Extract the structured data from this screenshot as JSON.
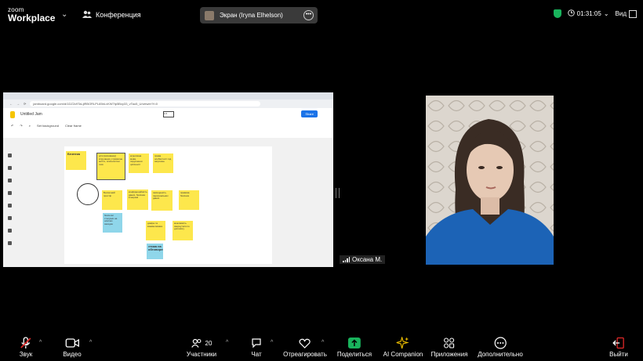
{
  "app": {
    "brand_line1": "zoom",
    "brand_line2": "Workplace",
    "meeting_title": "Конференция"
  },
  "screen_share": {
    "label": "Экран (Iryna Elhelson)"
  },
  "status": {
    "timer": "01:31:05",
    "view_label": "Вид"
  },
  "browser": {
    "url": "jamboard.google.com/d/1DZ2c9TaLjiRBORLPL65bLvKW7tp5Bxy33_vTao5_U/viewer?f=0",
    "doc_title": "Untitled Jam",
    "share_label": "Share",
    "page_indicator": "1/4",
    "set_background": "Set background",
    "clear_frame": "Clear frame"
  },
  "notes": [
    {
      "text": "Безпека"
    },
    {
      "text": "діти (вихованці) втручання у приватне життя, психологічні тиск"
    },
    {
      "text": "агресивна мова, порушення цілісності"
    },
    {
      "text": "права особистості під загрозою"
    },
    {
      "text": "Безпечний простір"
    },
    {
      "text": "конфіденційність даних, безпека в мережі"
    },
    {
      "text": "захищеність персональних даних"
    },
    {
      "text": "правова безпека"
    },
    {
      "text": "безпечні стосунки на освітніх заходах"
    },
    {
      "text": "довіра та взаємоповага"
    },
    {
      "text": "можливість звернутися по допомогу"
    },
    {
      "text": "етика на обговоренні"
    }
  ],
  "participant": {
    "name": "Оксана М."
  },
  "toolbar": {
    "audio": "Звук",
    "video": "Видео",
    "participants": "Участники",
    "participants_count": "20",
    "chat": "Чат",
    "react": "Отреагировать",
    "share": "Поделиться",
    "ai": "AI Companion",
    "apps": "Приложения",
    "more": "Дополнительно",
    "leave": "Выйти"
  },
  "colors": {
    "share_green": "#19b35c",
    "leave_red": "#e02828",
    "note_yellow": "#fde74c",
    "note_blue": "#8fd6ea",
    "accent_blue": "#1a73e8"
  },
  "icons": [
    "people-icon",
    "ellipsis-icon",
    "shield-icon",
    "clock-icon",
    "grid-icon",
    "mic-muted-icon",
    "camera-icon",
    "participants-icon",
    "chat-icon",
    "heart-icon",
    "share-arrow-icon",
    "sparkle-icon",
    "apps-icon",
    "more-icon",
    "leave-icon"
  ]
}
